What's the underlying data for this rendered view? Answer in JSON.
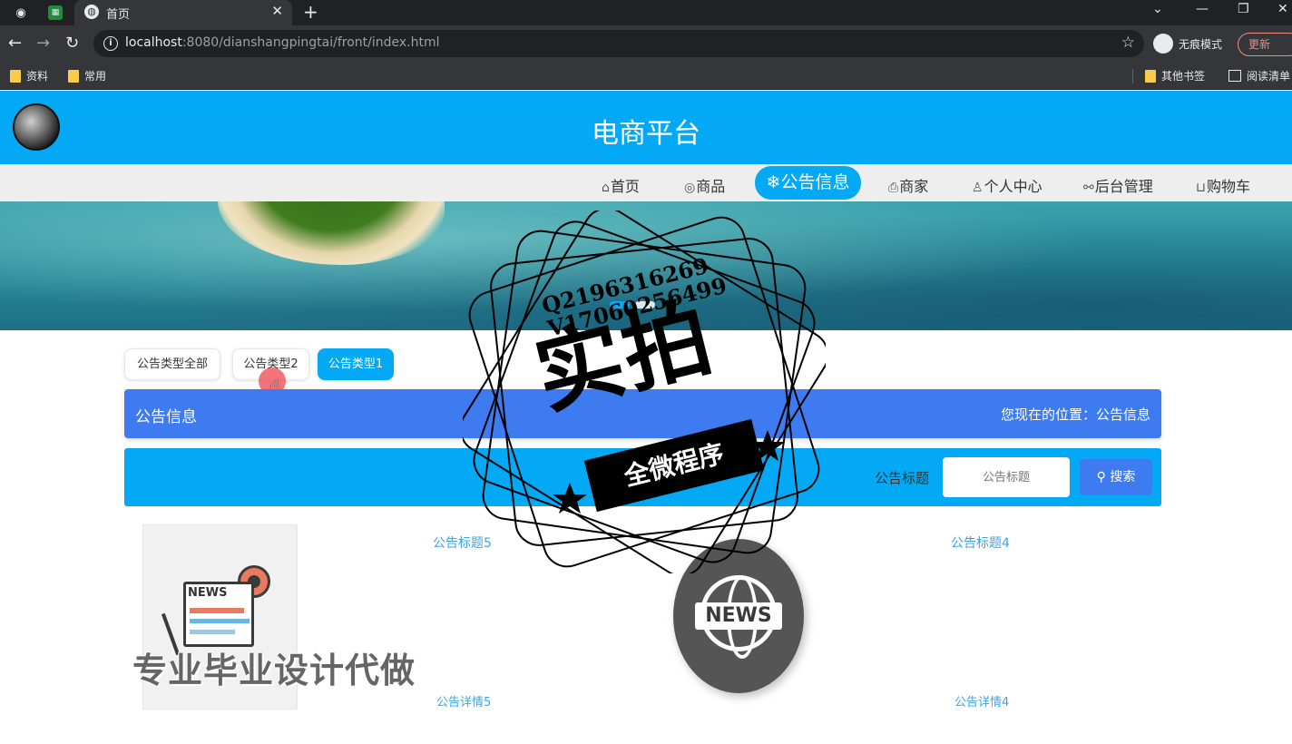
{
  "browser": {
    "tab_title": "首页",
    "url_host": "localhost",
    "url_rest": ":8080/dianshangpingtai/front/index.html",
    "incognito_label": "无痕模式",
    "update_label": "更新",
    "bookmarks": [
      "资料",
      "常用"
    ],
    "other_bookmarks": "其他书签",
    "reading_list": "阅读清单"
  },
  "site": {
    "title": "电商平台"
  },
  "nav": {
    "home": "首页",
    "goods": "商品",
    "notice": "公告信息",
    "merchant": "商家",
    "personal": "个人中心",
    "admin": "后台管理",
    "cart": "购物车"
  },
  "types": {
    "all": "公告类型全部",
    "type2": "公告类型2",
    "type1": "公告类型1"
  },
  "crumb": {
    "title": "公告信息",
    "position": "您现在的位置：公告信息"
  },
  "search": {
    "label": "公告标题",
    "placeholder": "公告标题",
    "button": "搜索"
  },
  "news": [
    {
      "title": "公告标题5",
      "detail": "公告详情5",
      "image_text": "NEWS"
    },
    {
      "title": "公告标题4",
      "detail": "公告详情4",
      "image_text": "NEWS"
    }
  ],
  "watermark": {
    "qq": "Q2196316269",
    "vx": "V17060256499",
    "big": "实拍",
    "ribbon": "全微程序",
    "bottom": "专业毕业设计代做"
  },
  "colors": {
    "primary": "#03a9f4",
    "crumb": "#3f7bf0",
    "link": "#3ba4e6"
  }
}
